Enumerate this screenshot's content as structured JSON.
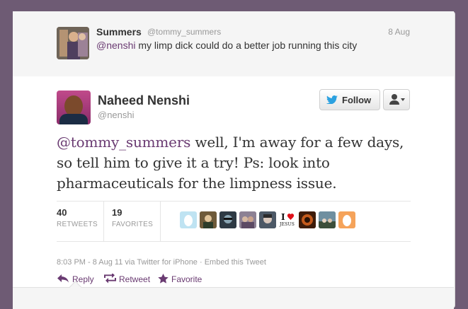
{
  "parent_tweet": {
    "name": "Summers",
    "handle": "@tommy_summers",
    "date": "8 Aug",
    "mention": "@nenshi",
    "text": " my limp dick could do a better job running this city"
  },
  "tweet": {
    "name": "Naheed Nenshi",
    "handle": "@nenshi",
    "follow_label": "Follow",
    "mention": "@tommy_summers",
    "text": " well, I'm away for a few days, so tell him to give it a try! Ps: look into pharmaceuticals for the limpness issue.",
    "retweets_count": "40",
    "retweets_label": "RETWEETS",
    "favorites_count": "19",
    "favorites_label": "FAVORITES",
    "meta": "8:03 PM - 8 Aug 11 via Twitter for iPhone · Embed this Tweet",
    "favoriters": [
      {
        "name": "default-egg-blue",
        "color": "#bfe3f2"
      },
      {
        "name": "user-2",
        "color": "#8a6a3a"
      },
      {
        "name": "user-3",
        "color": "#3b4a52"
      },
      {
        "name": "user-4",
        "color": "#8d8194"
      },
      {
        "name": "user-5",
        "color": "#55606e"
      },
      {
        "name": "i-love-jesus",
        "color": "#ffffff"
      },
      {
        "name": "user-7",
        "color": "#5a2a12"
      },
      {
        "name": "user-8",
        "color": "#4a6a7a"
      },
      {
        "name": "default-egg-orange",
        "color": "#f5a35a"
      }
    ],
    "jesus_top": "I",
    "jesus_bottom": "JESUS"
  },
  "actions": {
    "reply": "Reply",
    "retweet": "Retweet",
    "favorite": "Favorite"
  },
  "colors": {
    "accent": "#6a3b72",
    "background": "#6e5b74",
    "heart": "#e0111a"
  }
}
